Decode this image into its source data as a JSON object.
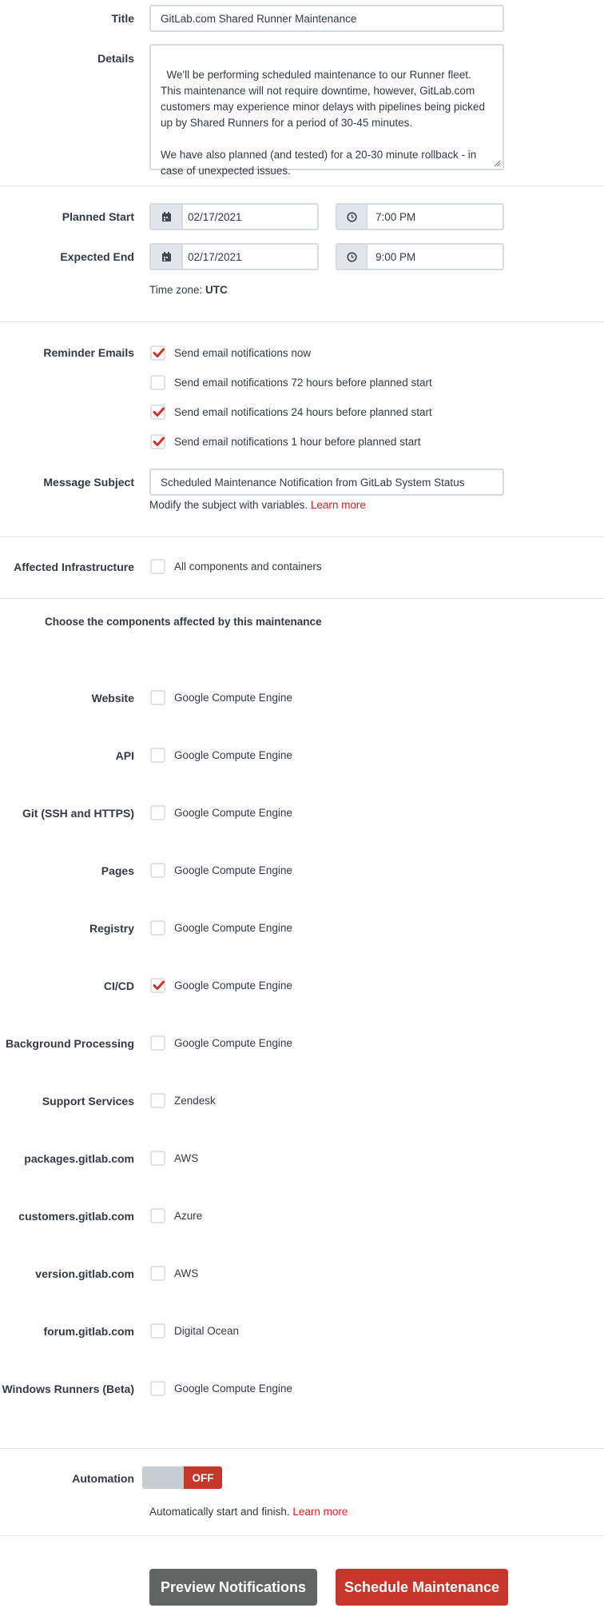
{
  "form": {
    "title_label": "Title",
    "title_value": "GitLab.com Shared Runner Maintenance",
    "details_label": "Details",
    "details_value": "We'll be performing scheduled maintenance to our Runner fleet. This maintenance will not require downtime, however, GitLab.com customers may experience minor delays with pipelines being picked up by Shared Runners for a period of 30-45 minutes.\n\nWe have also planned (and tested) for a 20-30 minute rollback - in case of unexpected issues.",
    "planned_start_label": "Planned Start",
    "planned_start_date": "02/17/2021",
    "planned_start_time": "7:00 PM",
    "expected_end_label": "Expected End",
    "expected_end_date": "02/17/2021",
    "expected_end_time": "9:00 PM",
    "timezone_prefix": "Time zone:",
    "timezone_value": "UTC"
  },
  "reminders": {
    "label": "Reminder Emails",
    "options": [
      {
        "label": "Send email notifications now",
        "checked": true
      },
      {
        "label": "Send email notifications 72 hours before planned start",
        "checked": false
      },
      {
        "label": "Send email notifications 24 hours before planned start",
        "checked": true
      },
      {
        "label": "Send email notifications 1 hour before planned start",
        "checked": true
      }
    ]
  },
  "subject": {
    "label": "Message Subject",
    "value": "Scheduled Maintenance Notification from GitLab System Status",
    "help_text": "Modify the subject with variables.",
    "help_link": "Learn more"
  },
  "infrastructure": {
    "label": "Affected Infrastructure",
    "all_label": "All components and containers",
    "all_checked": false
  },
  "components": {
    "heading": "Choose the components affected by this maintenance",
    "items": [
      {
        "name": "Website",
        "provider": "Google Compute Engine",
        "checked": false
      },
      {
        "name": "API",
        "provider": "Google Compute Engine",
        "checked": false
      },
      {
        "name": "Git (SSH and HTTPS)",
        "provider": "Google Compute Engine",
        "checked": false
      },
      {
        "name": "Pages",
        "provider": "Google Compute Engine",
        "checked": false
      },
      {
        "name": "Registry",
        "provider": "Google Compute Engine",
        "checked": false
      },
      {
        "name": "CI/CD",
        "provider": "Google Compute Engine",
        "checked": true
      },
      {
        "name": "Background Processing",
        "provider": "Google Compute Engine",
        "checked": false
      },
      {
        "name": "Support Services",
        "provider": "Zendesk",
        "checked": false
      },
      {
        "name": "packages.gitlab.com",
        "provider": "AWS",
        "checked": false
      },
      {
        "name": "customers.gitlab.com",
        "provider": "Azure",
        "checked": false
      },
      {
        "name": "version.gitlab.com",
        "provider": "AWS",
        "checked": false
      },
      {
        "name": "forum.gitlab.com",
        "provider": "Digital Ocean",
        "checked": false
      },
      {
        "name": "Windows Runners (Beta)",
        "provider": "Google Compute Engine",
        "checked": false
      }
    ]
  },
  "automation": {
    "label": "Automation",
    "state": "OFF",
    "help_text": "Automatically start and finish.",
    "help_link": "Learn more"
  },
  "actions": {
    "preview_label": "Preview Notifications",
    "schedule_label": "Schedule Maintenance"
  },
  "colors": {
    "accent": "#c7362b",
    "link": "#e01f1f",
    "text": "#333a45",
    "preview_button": "#626464"
  },
  "icons": {
    "date": "calendar-icon",
    "time": "clock-icon",
    "check": "checkmark-icon"
  }
}
